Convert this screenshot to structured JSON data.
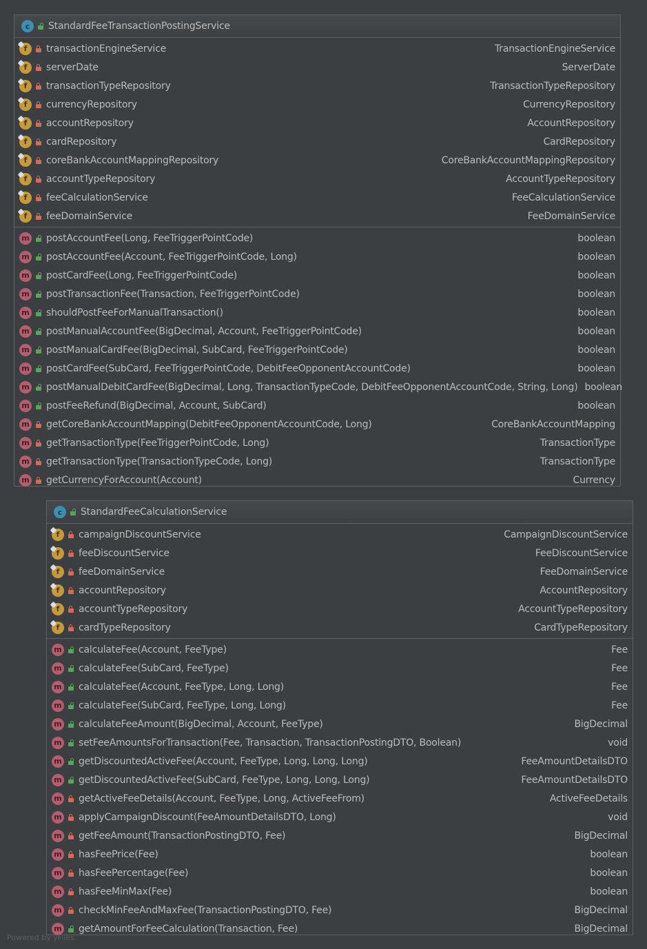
{
  "classes": [
    {
      "name": "StandardFeeTransactionPostingService",
      "kind": "class",
      "fields": [
        {
          "name": "transactionEngineService",
          "type": "TransactionEngineService"
        },
        {
          "name": "serverDate",
          "type": "ServerDate"
        },
        {
          "name": "transactionTypeRepository",
          "type": "TransactionTypeRepository"
        },
        {
          "name": "currencyRepository",
          "type": "CurrencyRepository"
        },
        {
          "name": "accountRepository",
          "type": "AccountRepository"
        },
        {
          "name": "cardRepository",
          "type": "CardRepository"
        },
        {
          "name": "coreBankAccountMappingRepository",
          "type": "CoreBankAccountMappingRepository"
        },
        {
          "name": "accountTypeRepository",
          "type": "AccountTypeRepository"
        },
        {
          "name": "feeCalculationService",
          "type": "FeeCalculationService"
        },
        {
          "name": "feeDomainService",
          "type": "FeeDomainService"
        }
      ],
      "methods": [
        {
          "name": "postAccountFee(Long, FeeTriggerPointCode)",
          "type": "boolean",
          "visibility": "public"
        },
        {
          "name": "postAccountFee(Account, FeeTriggerPointCode, Long)",
          "type": "boolean",
          "visibility": "public"
        },
        {
          "name": "postCardFee(Long, FeeTriggerPointCode)",
          "type": "boolean",
          "visibility": "public"
        },
        {
          "name": "postTransactionFee(Transaction, FeeTriggerPointCode)",
          "type": "boolean",
          "visibility": "public"
        },
        {
          "name": "shouldPostFeeForManualTransaction()",
          "type": "boolean",
          "visibility": "public"
        },
        {
          "name": "postManualAccountFee(BigDecimal, Account, FeeTriggerPointCode)",
          "type": "boolean",
          "visibility": "public"
        },
        {
          "name": "postManualCardFee(BigDecimal, SubCard, FeeTriggerPointCode)",
          "type": "boolean",
          "visibility": "public"
        },
        {
          "name": "postCardFee(SubCard, FeeTriggerPointCode, DebitFeeOpponentAccountCode)",
          "type": "boolean",
          "visibility": "public"
        },
        {
          "name": "postManualDebitCardFee(BigDecimal, Long, TransactionTypeCode, DebitFeeOpponentAccountCode, String, Long)",
          "type": "boolean",
          "visibility": "public"
        },
        {
          "name": "postFeeRefund(BigDecimal, Account, SubCard)",
          "type": "boolean",
          "visibility": "public"
        },
        {
          "name": "getCoreBankAccountMapping(DebitFeeOpponentAccountCode, Long)",
          "type": "CoreBankAccountMapping",
          "visibility": "private"
        },
        {
          "name": "getTransactionType(FeeTriggerPointCode, Long)",
          "type": "TransactionType",
          "visibility": "private"
        },
        {
          "name": "getTransactionType(TransactionTypeCode, Long)",
          "type": "TransactionType",
          "visibility": "private"
        },
        {
          "name": "getCurrencyForAccount(Account)",
          "type": "Currency",
          "visibility": "private"
        }
      ]
    },
    {
      "name": "StandardFeeCalculationService",
      "kind": "class",
      "fields": [
        {
          "name": "campaignDiscountService",
          "type": "CampaignDiscountService"
        },
        {
          "name": "feeDiscountService",
          "type": "FeeDiscountService"
        },
        {
          "name": "feeDomainService",
          "type": "FeeDomainService"
        },
        {
          "name": "accountRepository",
          "type": "AccountRepository"
        },
        {
          "name": "accountTypeRepository",
          "type": "AccountTypeRepository"
        },
        {
          "name": "cardTypeRepository",
          "type": "CardTypeRepository"
        }
      ],
      "methods": [
        {
          "name": "calculateFee(Account, FeeType)",
          "type": "Fee",
          "visibility": "public"
        },
        {
          "name": "calculateFee(SubCard, FeeType)",
          "type": "Fee",
          "visibility": "public"
        },
        {
          "name": "calculateFee(Account, FeeType, Long, Long)",
          "type": "Fee",
          "visibility": "public"
        },
        {
          "name": "calculateFee(SubCard, FeeType, Long, Long)",
          "type": "Fee",
          "visibility": "public"
        },
        {
          "name": "calculateFeeAmount(BigDecimal, Account, FeeType)",
          "type": "BigDecimal",
          "visibility": "public"
        },
        {
          "name": "setFeeAmountsForTransaction(Fee, Transaction, TransactionPostingDTO, Boolean)",
          "type": "void",
          "visibility": "public"
        },
        {
          "name": "getDiscountedActiveFee(Account, FeeType, Long, Long, Long)",
          "type": "FeeAmountDetailsDTO",
          "visibility": "public"
        },
        {
          "name": "getDiscountedActiveFee(SubCard, FeeType, Long, Long, Long)",
          "type": "FeeAmountDetailsDTO",
          "visibility": "public"
        },
        {
          "name": "getActiveFeeDetails(Account, FeeType, Long, ActiveFeeFrom)",
          "type": "ActiveFeeDetails",
          "visibility": "private"
        },
        {
          "name": "applyCampaignDiscount(FeeAmountDetailsDTO, Long)",
          "type": "void",
          "visibility": "private"
        },
        {
          "name": "getFeeAmount(TransactionPostingDTO, Fee)",
          "type": "BigDecimal",
          "visibility": "private"
        },
        {
          "name": "hasFeePrice(Fee)",
          "type": "boolean",
          "visibility": "private"
        },
        {
          "name": "hasFeePercentage(Fee)",
          "type": "boolean",
          "visibility": "private"
        },
        {
          "name": "hasFeeMinMax(Fee)",
          "type": "boolean",
          "visibility": "private"
        },
        {
          "name": "checkMinFeeAndMaxFee(TransactionPostingDTO, Fee)",
          "type": "BigDecimal",
          "visibility": "private"
        },
        {
          "name": "getAmountForFeeCalculation(Transaction, Fee)",
          "type": "BigDecimal",
          "visibility": "public"
        }
      ]
    }
  ],
  "icons": {
    "class_letter": "c",
    "field_letter": "f",
    "method_letter": "m"
  },
  "watermark": "Powered by yFiles"
}
